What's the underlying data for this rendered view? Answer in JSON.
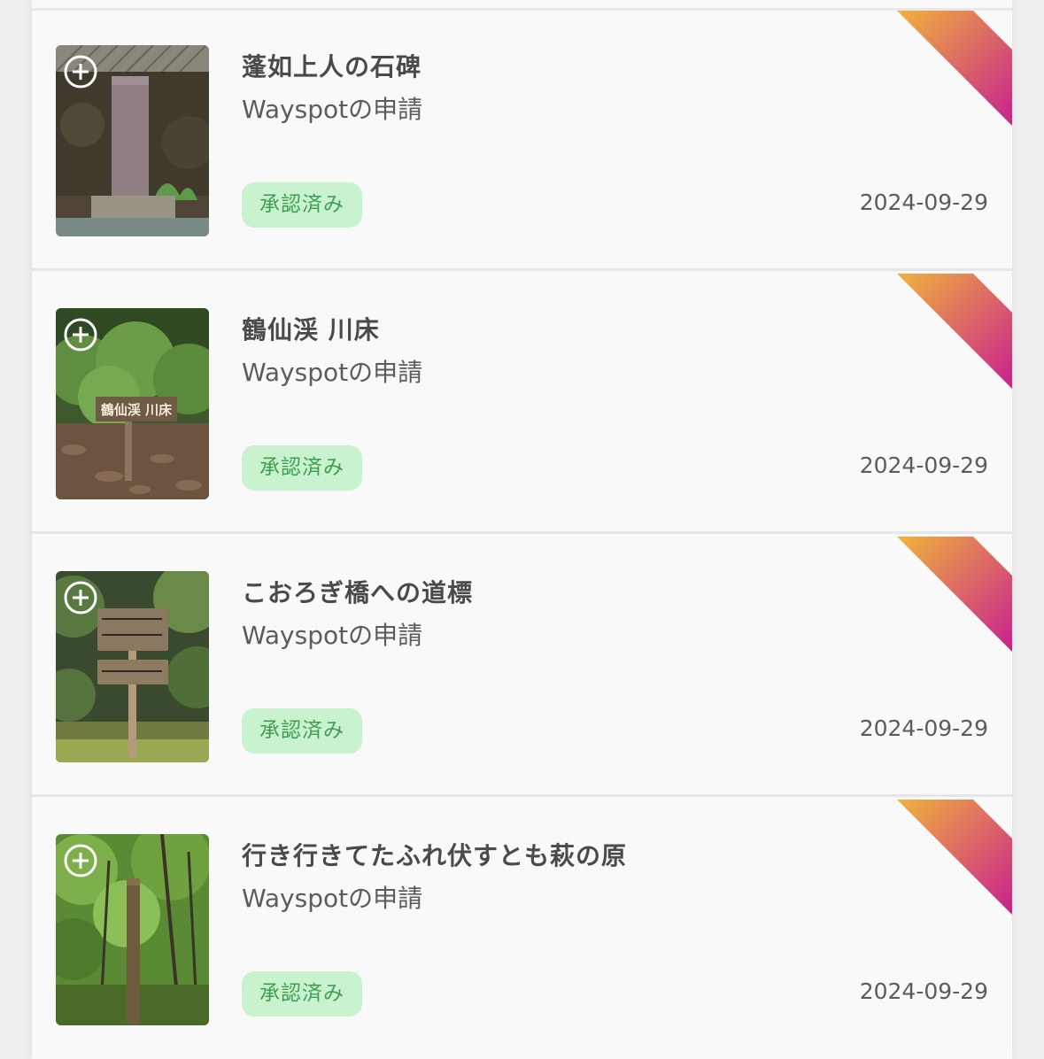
{
  "items": [
    {
      "title": "蓬如上人の石碑",
      "type_label": "Wayspotの申請",
      "status": "承認済み",
      "date": "2024-09-29",
      "thumbnail_icon": "photo-stone-monument"
    },
    {
      "title": "鶴仙渓 川床",
      "type_label": "Wayspotの申請",
      "status": "承認済み",
      "date": "2024-09-29",
      "thumbnail_icon": "photo-wooden-sign",
      "thumbnail_sign_text": "鶴仙渓 川床"
    },
    {
      "title": "こおろぎ橋への道標",
      "type_label": "Wayspotの申請",
      "status": "承認済み",
      "date": "2024-09-29",
      "thumbnail_icon": "photo-signpost"
    },
    {
      "title": "行き行きてたふれ伏すとも萩の原",
      "type_label": "Wayspotの申請",
      "status": "承認済み",
      "date": "2024-09-29",
      "thumbnail_icon": "photo-forest-pillar"
    }
  ],
  "colors": {
    "ribbon_start": "#f0b33c",
    "ribbon_end": "#c8208e",
    "badge_bg": "#c9f2cf",
    "badge_text": "#3f9e52"
  }
}
